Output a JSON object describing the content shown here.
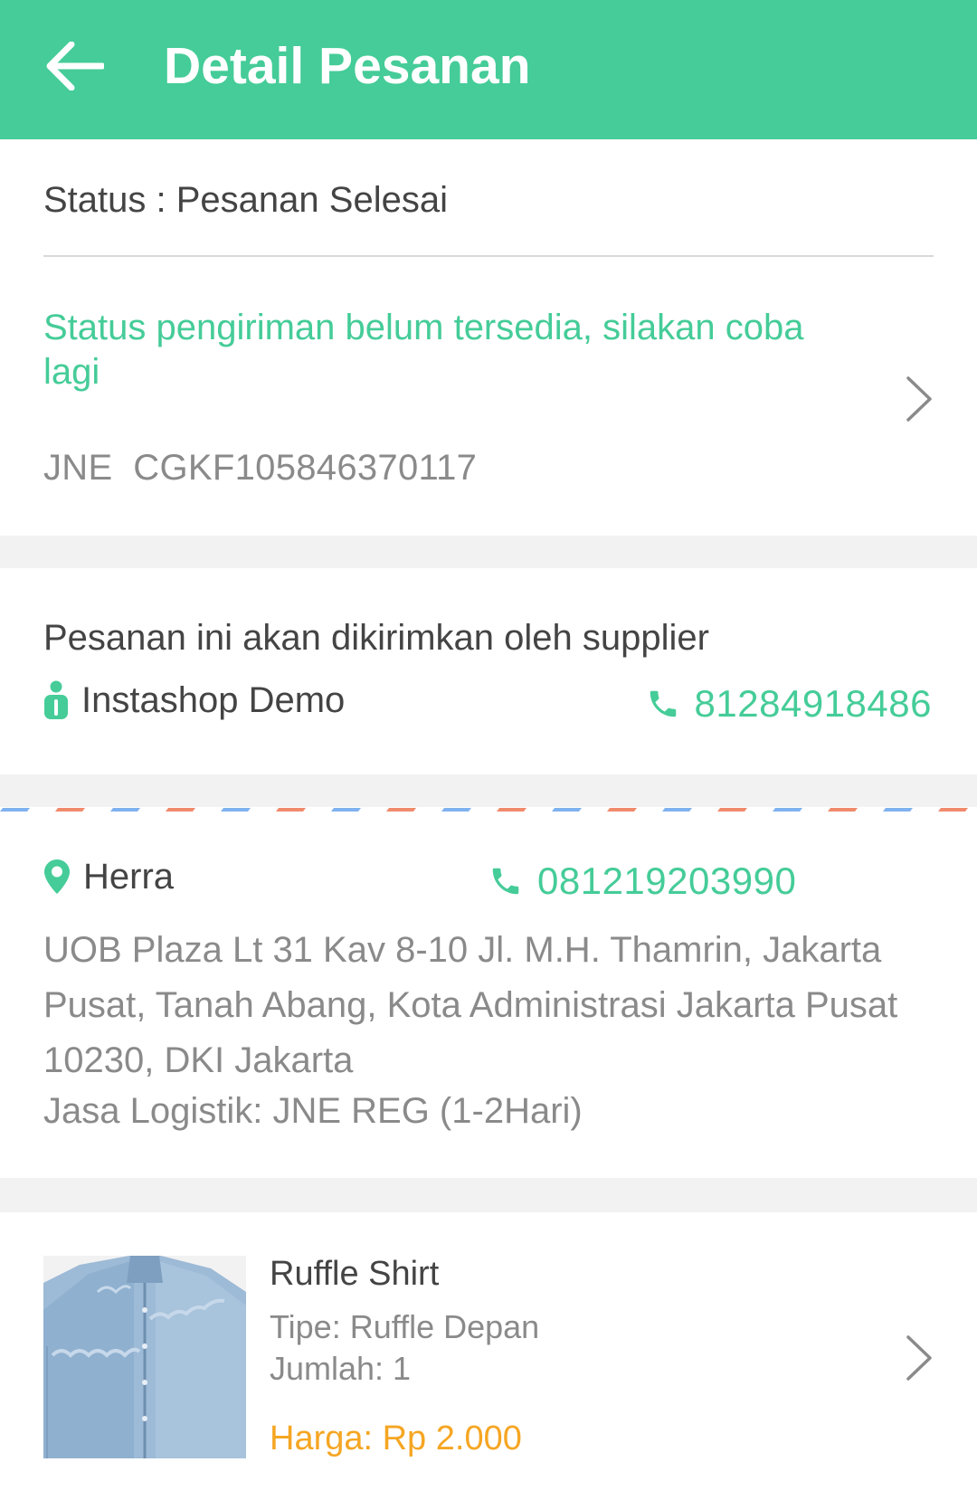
{
  "appbar": {
    "title": "Detail Pesanan",
    "back_icon": "arrow-left-icon",
    "background": "#45cc98"
  },
  "order_status": {
    "text": "Status : Pesanan Selesai"
  },
  "shipping": {
    "message": "Status pengiriman belum tersedia, silakan coba lagi",
    "tracking": "JNE  CGKF105846370117",
    "chevron_icon": "chevron-right-icon"
  },
  "supplier": {
    "note": "Pesanan ini akan dikirimkan oleh supplier",
    "name": "Instashop Demo",
    "name_icon": "person-icon",
    "phone": "81284918486",
    "phone_icon": "phone-icon"
  },
  "recipient": {
    "name": "Herra",
    "name_icon": "location-pin-icon",
    "phone": "081219203990",
    "phone_icon": "phone-icon",
    "address": "UOB Plaza Lt 31 Kav 8-10 Jl. M.H. Thamrin, Jakarta Pusat, Tanah Abang, Kota Administrasi Jakarta Pusat 10230, DKI Jakarta",
    "logistics": "Jasa Logistik: JNE REG (1-2Hari)"
  },
  "product": {
    "name": "Ruffle Shirt",
    "type": "Tipe: Ruffle Depan",
    "quantity": "Jumlah: 1",
    "price": "Harga: Rp 2.000",
    "price_color": "#f5a623",
    "chevron_icon": "chevron-right-icon"
  },
  "colors": {
    "accent": "#45cc98",
    "text_primary": "#444444",
    "text_secondary": "#8a8a8a",
    "separator": "#f2f2f2",
    "airmail_red": "#f08a6c",
    "airmail_blue": "#7fb2ef"
  }
}
